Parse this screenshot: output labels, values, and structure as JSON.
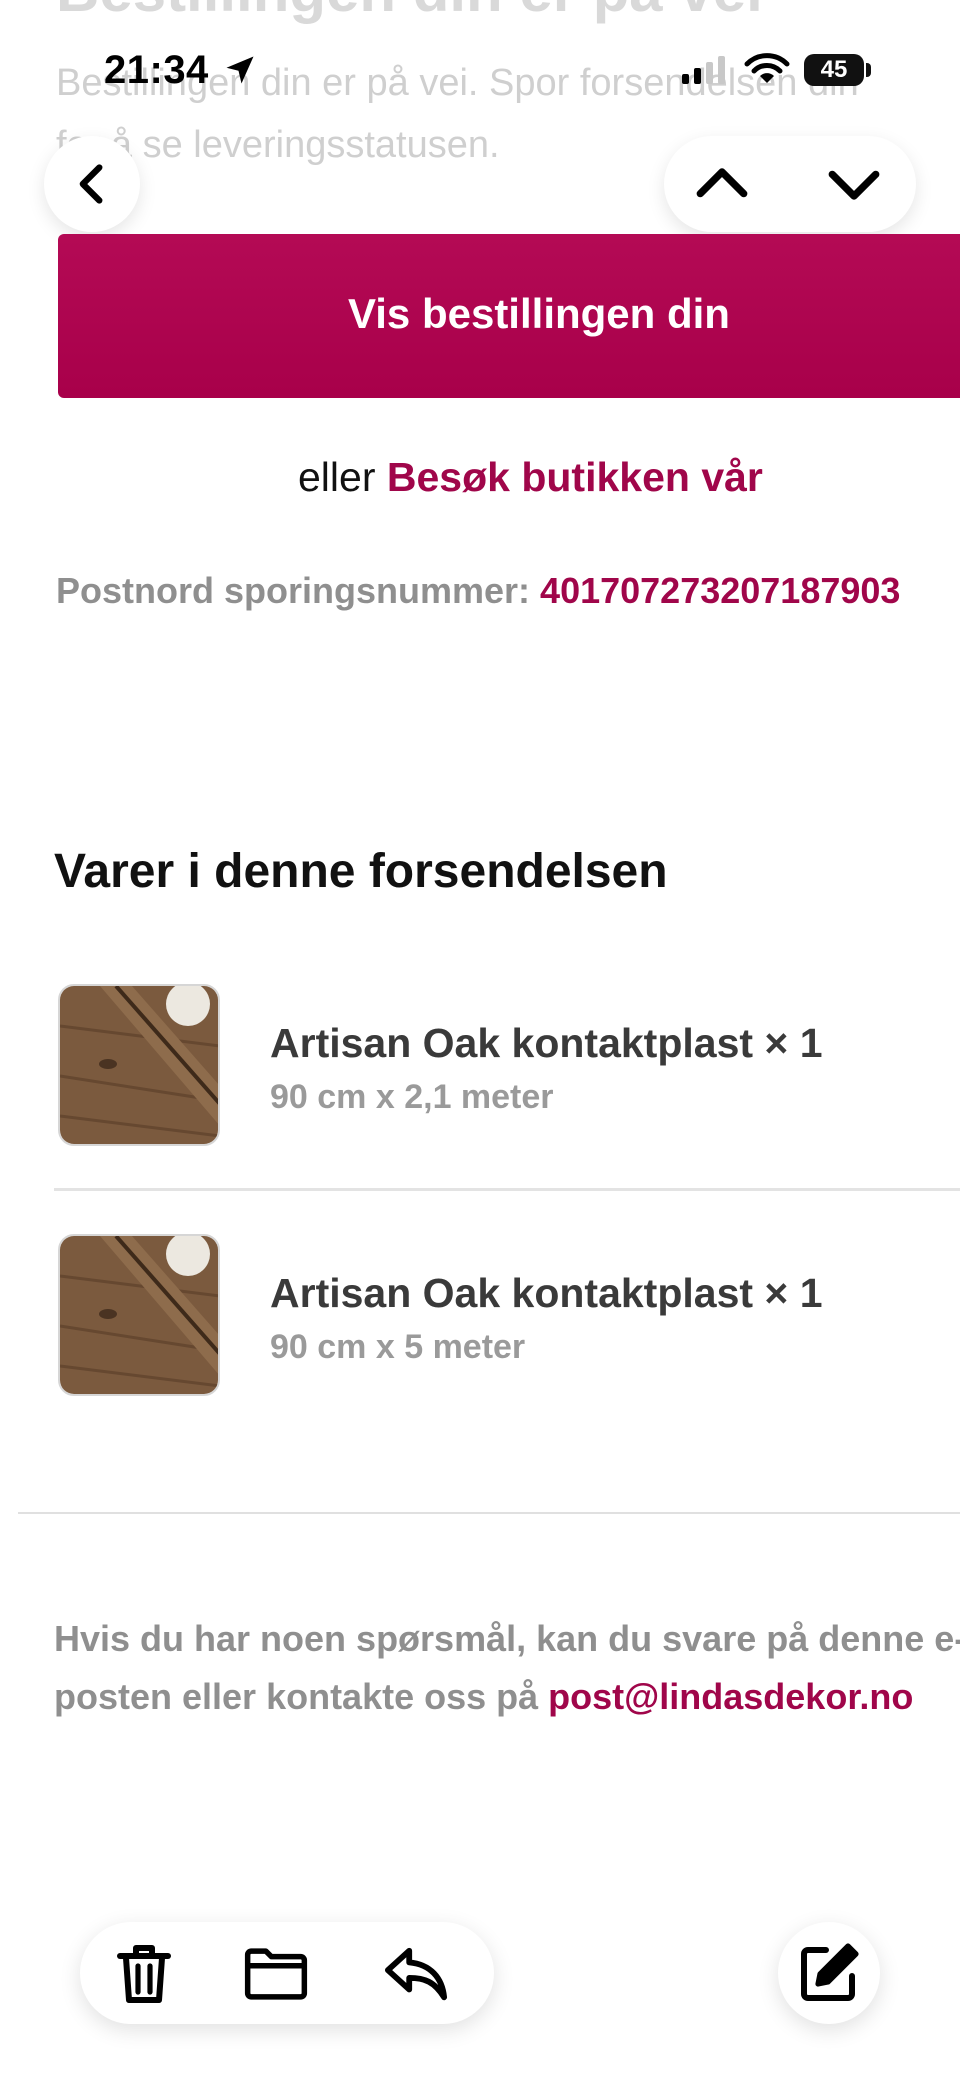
{
  "email": {
    "heading": "Bestillingen din er på vei",
    "intro_line_1": "Bestillingen din er på vei. Spor forsendelsen din",
    "intro_line_2": "for å se leveringsstatusen.",
    "cta_label": "Vis bestillingen din",
    "or_text": "eller",
    "store_link": "Besøk butikken vår",
    "tracking_label": "Postnord sporingsnummer:",
    "tracking_number": "401707273207187903",
    "items_title": "Varer i denne forsendelsen",
    "items": [
      {
        "name": "Artisan Oak kontaktplast × 1",
        "variant": "90 cm x 2,1 meter"
      },
      {
        "name": "Artisan Oak kontaktplast × 1",
        "variant": "90 cm x 5 meter"
      }
    ],
    "footer_line_1": "Hvis du har noen spørsmål, kan du svare på denne e-",
    "footer_line_2_prefix": "posten eller kontakte oss på",
    "footer_email": "post@lindasdekor.no"
  },
  "status_bar": {
    "time": "21:34",
    "battery": "45"
  },
  "nav": {
    "back_icon": "chevron-left",
    "prev_icon": "chevron-up",
    "next_icon": "chevron-down"
  },
  "toolbar": {
    "icons": [
      "trash",
      "folder",
      "reply",
      "compose"
    ]
  },
  "colors": {
    "accent": "#a8004a",
    "link": "#a0064a",
    "muted_text": "#8f8f8f"
  }
}
